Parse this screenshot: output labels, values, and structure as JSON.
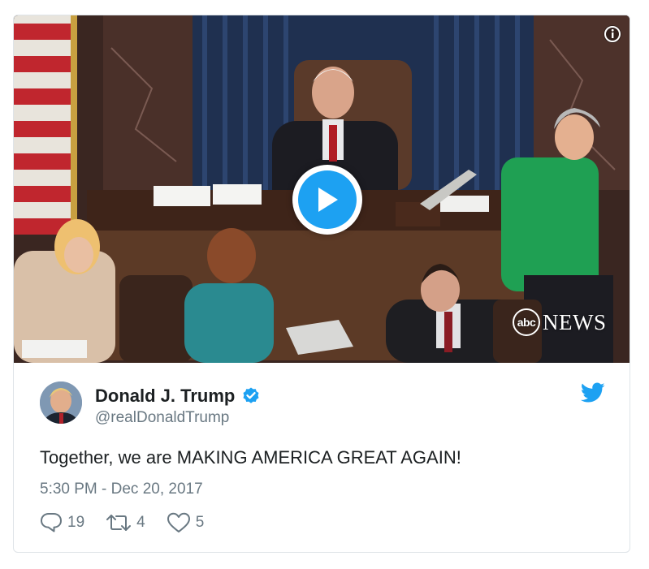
{
  "media": {
    "watermark_abc": "abc",
    "watermark_news": "NEWS",
    "play_icon": "play-icon",
    "info_icon": "info-icon"
  },
  "author": {
    "name": "Donald J. Trump",
    "handle": "@realDonaldTrump",
    "verified": true
  },
  "tweet": {
    "text": "Together, we are MAKING AMERICA GREAT AGAIN!",
    "timestamp": "5:30 PM - Dec 20, 2017"
  },
  "actions": {
    "replies": "19",
    "retweets": "4",
    "likes": "5"
  },
  "colors": {
    "accent": "#1da1f2",
    "text": "#1c2022",
    "muted": "#697882",
    "border": "#dfe4e8"
  }
}
